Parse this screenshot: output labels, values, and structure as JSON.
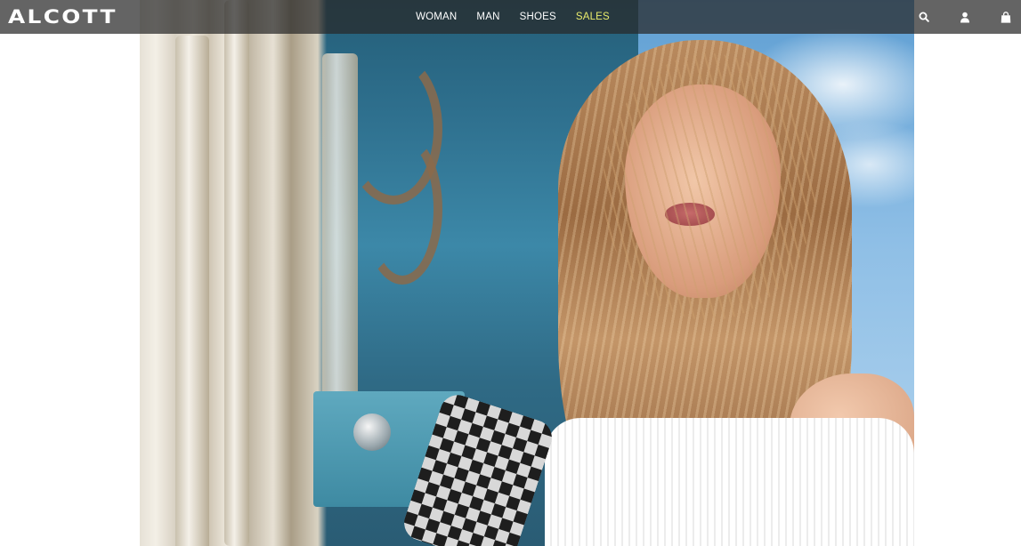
{
  "header": {
    "logo_text": "ALCOTT",
    "nav": [
      {
        "label": "WOMAN"
      },
      {
        "label": "MAN"
      },
      {
        "label": "SHOES"
      },
      {
        "label": "SALES"
      }
    ],
    "icons": [
      "search-icon",
      "user-icon",
      "shopping-bag-icon"
    ]
  },
  "colors": {
    "nav_background": "#282828",
    "nav_text": "#ffffff",
    "sales_accent": "#e9ec6c",
    "page_background": "#ffffff"
  }
}
